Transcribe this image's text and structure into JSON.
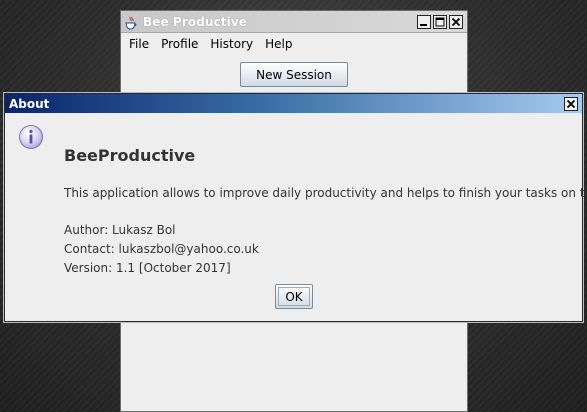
{
  "main_window": {
    "title": "Bee Productive",
    "menu": [
      "File",
      "Profile",
      "History",
      "Help"
    ],
    "new_session_label": "New Session"
  },
  "about_dialog": {
    "title": "About",
    "app_name": "BeeProductive",
    "description": "This application allows to improve daily productivity and helps to finish your tasks on time.",
    "author": "Author: Lukasz Bol",
    "contact": "Contact: lukaszbol@yahoo.co.uk",
    "version": "Version: 1.1  [October 2017]",
    "ok_label": "OK"
  },
  "icons": {
    "app_icon": "java-cup-icon",
    "info_icon": "info-icon",
    "minimize": "minimize-icon",
    "maximize": "maximize-icon",
    "close": "close-icon"
  },
  "colors": {
    "dialog_title_start": "#0a246a",
    "dialog_title_end": "#a6caf0",
    "window_bg": "#eeeeee",
    "text": "#333333"
  }
}
